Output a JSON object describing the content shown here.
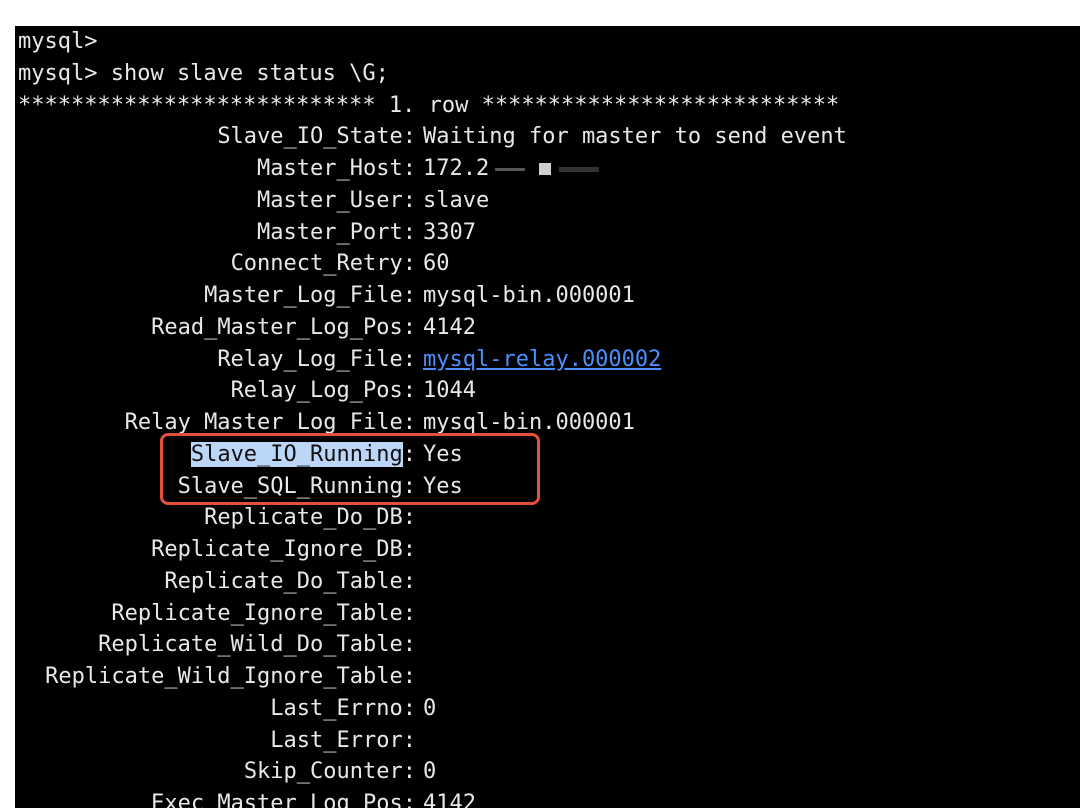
{
  "terminal": {
    "prompt_line": "mysql>",
    "command_line": "mysql> show slave status \\G;",
    "row_header": "*************************** 1. row ***************************",
    "fields": [
      {
        "key": "Slave_IO_State:",
        "value": "Waiting for master to send event"
      },
      {
        "key": "Master_Host:",
        "value": "172.2"
      },
      {
        "key": "Master_User:",
        "value": "slave"
      },
      {
        "key": "Master_Port:",
        "value": "3307"
      },
      {
        "key": "Connect_Retry:",
        "value": "60"
      },
      {
        "key": "Master_Log_File:",
        "value": "mysql-bin.000001"
      },
      {
        "key": "Read_Master_Log_Pos:",
        "value": "4142"
      },
      {
        "key": "Relay_Log_File:",
        "value": "mysql-relay.000002"
      },
      {
        "key": "Relay_Log_Pos:",
        "value": "1044"
      },
      {
        "key": "Relay_Master_Log_File:",
        "value": "mysql-bin.000001"
      },
      {
        "key": "Slave_IO_Running",
        "value": "Yes"
      },
      {
        "key": "Slave_SQL_Running:",
        "value": "Yes"
      },
      {
        "key": "Replicate_Do_DB:",
        "value": ""
      },
      {
        "key": "Replicate_Ignore_DB:",
        "value": ""
      },
      {
        "key": "Replicate_Do_Table:",
        "value": ""
      },
      {
        "key": "Replicate_Ignore_Table:",
        "value": ""
      },
      {
        "key": "Replicate_Wild_Do_Table:",
        "value": ""
      },
      {
        "key": "Replicate_Wild_Ignore_Table:",
        "value": ""
      },
      {
        "key": "Last_Errno:",
        "value": "0"
      },
      {
        "key": "Last_Error:",
        "value": ""
      },
      {
        "key": "Skip_Counter:",
        "value": "0"
      },
      {
        "key": "Exec_Master_Log_Pos:",
        "value": "4142"
      }
    ]
  },
  "colors": {
    "terminal_bg": "#000000",
    "text": "#e8e8e8",
    "link": "#4a8fff",
    "selection": "#bcd6f8",
    "annotation_box": "#e5503c"
  }
}
